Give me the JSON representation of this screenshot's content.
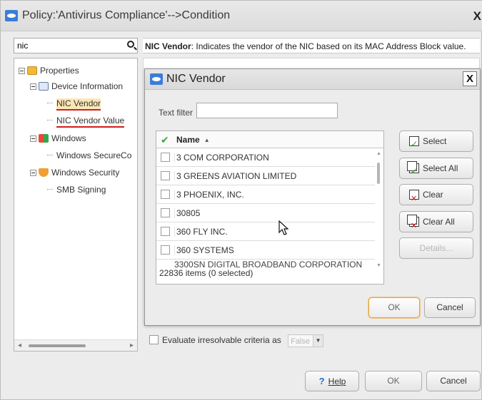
{
  "window": {
    "title": "Policy:'Antivirus Compliance'-->Condition",
    "close_label": "X"
  },
  "tree": {
    "search_value": "nic",
    "nodes": [
      {
        "label": "Properties",
        "icon": "properties-icon"
      },
      {
        "label": "Device Information",
        "icon": "device-information-icon"
      },
      {
        "label": "NIC Vendor",
        "icon": "none"
      },
      {
        "label": "NIC Vendor Value",
        "icon": "none"
      },
      {
        "label": "Windows",
        "icon": "windows-icon"
      },
      {
        "label": "Windows SecureCo",
        "icon": "none"
      },
      {
        "label": "Windows Security",
        "icon": "shield-icon"
      },
      {
        "label": "SMB Signing",
        "icon": "none"
      }
    ]
  },
  "description": {
    "bold": "NIC Vendor",
    "text": ": Indicates the vendor of the NIC based on its MAC Address Block value."
  },
  "evaluate": {
    "label": "Evaluate irresolvable criteria as",
    "value": "False"
  },
  "main_buttons": {
    "help": "Help",
    "ok": "OK",
    "cancel": "Cancel"
  },
  "dialog": {
    "title": "NIC Vendor",
    "close_label": "X",
    "filter_label": "Text filter",
    "filter_value": "",
    "column_name": "Name",
    "rows": [
      "3 COM CORPORATION",
      "3 GREENS AVIATION LIMITED",
      "3 PHOENIX, INC.",
      "30805",
      "360 FLY INC.",
      "360 SYSTEMS"
    ],
    "partial_row": "3300SN DIGITAL BROADBAND CORPORATION",
    "status": "22836 items (0 selected)",
    "side_buttons": {
      "select": "Select",
      "select_all": "Select All",
      "clear": "Clear",
      "clear_all": "Clear All",
      "details": "Details..."
    },
    "ok": "OK",
    "cancel": "Cancel"
  },
  "colors": {
    "accent_blue": "#3b7dd8",
    "underline_red": "#d21c1c",
    "selection": "#fbe7b5",
    "check_green": "#3ea73a"
  }
}
